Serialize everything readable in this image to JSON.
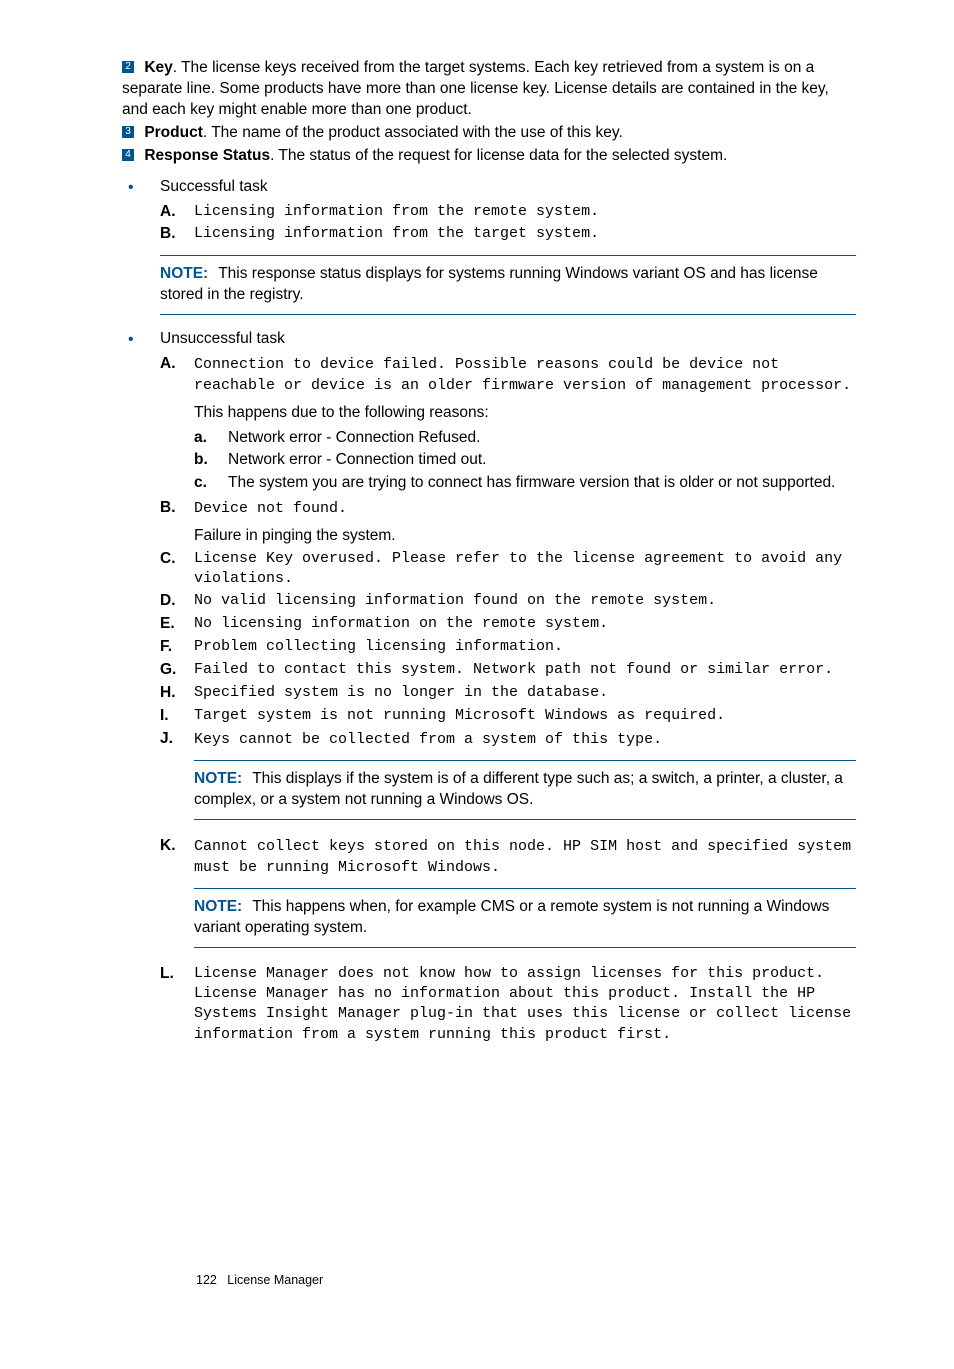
{
  "numbered": [
    {
      "n": "2",
      "term": "Key",
      "text": ". The license keys received from the target systems. Each key retrieved from a system is on a separate line. Some products have more than one license key. License details are contained in the key, and each key might enable more than one product."
    },
    {
      "n": "3",
      "term": "Product",
      "text": ". The name of the product associated with the use of this key."
    },
    {
      "n": "4",
      "term": "Response Status",
      "text": ". The status of the request for license data for the selected system."
    }
  ],
  "success": {
    "title": "Successful task",
    "items": [
      {
        "m": "A.",
        "mono": "Licensing information from the remote system."
      },
      {
        "m": "B.",
        "mono": "Licensing information from the target system."
      }
    ],
    "note": {
      "label": "NOTE:",
      "text": "This response status displays for systems running Windows variant OS and has license stored in the registry."
    }
  },
  "unsuccess": {
    "title": "Unsuccessful task",
    "A": {
      "m": "A.",
      "mono": "Connection to device failed. Possible reasons could be device not reachable or device is an older firmware version of management processor.",
      "after": "This happens due to the following reasons:",
      "sub": [
        {
          "m": "a.",
          "text": "Network error - Connection Refused."
        },
        {
          "m": "b.",
          "text": "Network error - Connection timed out."
        },
        {
          "m": "c.",
          "text": "The system you are trying to connect has firmware version that is older or not supported."
        }
      ]
    },
    "B": {
      "m": "B.",
      "mono": "Device not found.",
      "after": "Failure in pinging the system."
    },
    "C": {
      "m": "C.",
      "mono": "License Key overused. Please refer to the license agreement to avoid any violations."
    },
    "D": {
      "m": "D.",
      "mono": "No valid licensing information found on the remote system."
    },
    "E": {
      "m": "E.",
      "mono": "No licensing information on the remote system."
    },
    "F": {
      "m": "F.",
      "mono": "Problem collecting licensing information."
    },
    "G": {
      "m": "G.",
      "mono": "Failed to contact this system. Network path not found or similar error."
    },
    "H": {
      "m": "H.",
      "mono": "Specified system is no longer in the database."
    },
    "I": {
      "m": "I.",
      "mono": "Target system is not running Microsoft Windows as required."
    },
    "J": {
      "m": "J.",
      "mono": "Keys cannot be collected from a system of this type.",
      "note": {
        "label": "NOTE:",
        "text": "This displays if the system is of a different type such as; a switch, a printer, a cluster, a complex, or a system not running a Windows OS."
      }
    },
    "K": {
      "m": "K.",
      "mono": "Cannot collect keys stored on this node. HP SIM host and specified system must be running Microsoft Windows.",
      "note": {
        "label": "NOTE:",
        "text": "This happens when, for example CMS or a remote system is not running a Windows variant operating system."
      }
    },
    "L": {
      "m": "L.",
      "mono": "License Manager does not know how to assign licenses for this product. License Manager has no information about this product. Install the HP Systems Insight Manager plug-in that uses this license or collect license information from a system running this product first."
    }
  },
  "footer": {
    "page": "122",
    "title": "License Manager"
  }
}
